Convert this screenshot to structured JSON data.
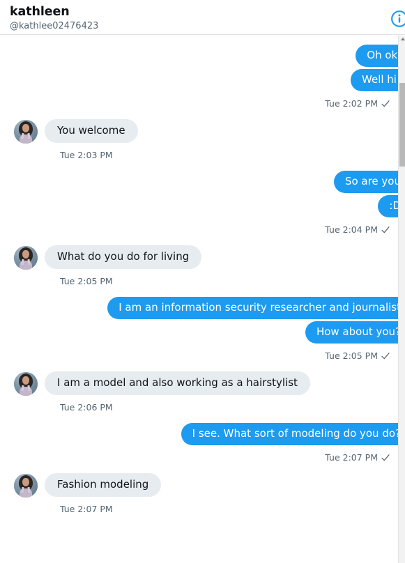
{
  "header": {
    "title": "kathleen",
    "handle": "@kathlee02476423",
    "info_icon": "info-circle-icon"
  },
  "conversation": [
    {
      "direction": "out",
      "messages": [
        "Oh ok.",
        "Well hi!"
      ],
      "timestamp": "Tue 2:02 PM",
      "delivered": true,
      "check_icon": "checkmark-icon"
    },
    {
      "direction": "in",
      "messages": [
        "You welcome"
      ],
      "timestamp": "Tue 2:03 PM",
      "delivered": false
    },
    {
      "direction": "out",
      "messages": [
        "So are you",
        ":D"
      ],
      "timestamp": "Tue 2:04 PM",
      "delivered": true,
      "check_icon": "checkmark-icon"
    },
    {
      "direction": "in",
      "messages": [
        "What do you do for living"
      ],
      "timestamp": "Tue 2:05 PM",
      "delivered": false
    },
    {
      "direction": "out",
      "messages": [
        "I am an information security researcher and journalist",
        "How about you?"
      ],
      "timestamp": "Tue 2:05 PM",
      "delivered": true,
      "check_icon": "checkmark-icon"
    },
    {
      "direction": "in",
      "messages": [
        "I am a model and also working as a hairstylist"
      ],
      "timestamp": "Tue 2:06 PM",
      "delivered": false
    },
    {
      "direction": "out",
      "messages": [
        "I see. What sort of modeling do you do?"
      ],
      "timestamp": "Tue 2:07 PM",
      "delivered": true,
      "check_icon": "checkmark-icon"
    },
    {
      "direction": "in",
      "messages": [
        "Fashion modeling"
      ],
      "timestamp": "Tue 2:07 PM",
      "delivered": false
    }
  ],
  "avatar": {
    "name": "kathleen-avatar"
  },
  "colors": {
    "outgoing_bubble": "#1d9bf0",
    "incoming_bubble": "#e7ecf0",
    "outgoing_text": "#ffffff",
    "incoming_text": "#0f1419",
    "timestamp": "#536471",
    "accent": "#1d9bf0",
    "background": "#ffffff"
  },
  "scrollbar": {
    "name": "thread-scrollbar",
    "orientation": "vertical"
  }
}
